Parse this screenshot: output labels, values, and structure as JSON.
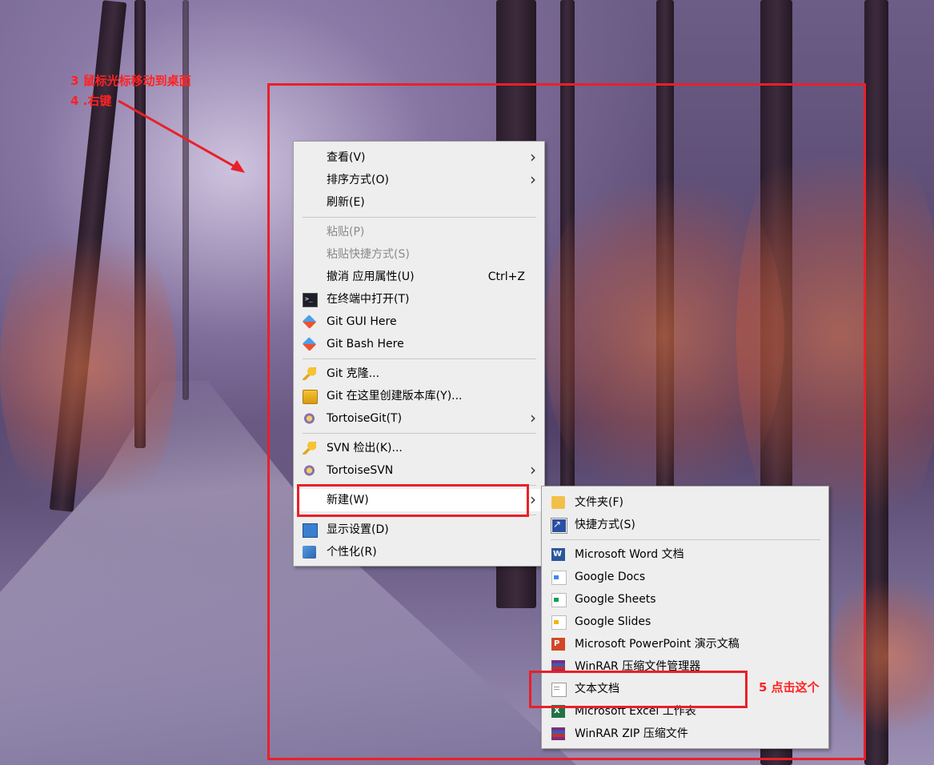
{
  "annotations": {
    "step3": "3 鼠标光标移动到桌面",
    "step4": "4 .右键",
    "step5": "5 点击这个"
  },
  "context_menu": {
    "items": [
      {
        "label": "查看(V)",
        "submenu": true
      },
      {
        "label": "排序方式(O)",
        "submenu": true
      },
      {
        "label": "刷新(E)"
      },
      {
        "label": "粘贴(P)",
        "disabled": true
      },
      {
        "label": "粘贴快捷方式(S)",
        "disabled": true
      },
      {
        "label": "撤消 应用属性(U)",
        "shortcut": "Ctrl+Z"
      },
      {
        "label": "在终端中打开(T)",
        "icon": "terminal-icon"
      },
      {
        "label": "Git GUI Here",
        "icon": "git-icon"
      },
      {
        "label": "Git Bash Here",
        "icon": "git-icon"
      },
      {
        "label": "Git 克隆...",
        "icon": "tortoisegit-clone-icon"
      },
      {
        "label": "Git 在这里创建版本库(Y)...",
        "icon": "repo-create-icon"
      },
      {
        "label": "TortoiseGit(T)",
        "icon": "tortoisegit-icon",
        "submenu": true
      },
      {
        "label": "SVN 检出(K)...",
        "icon": "svn-checkout-icon"
      },
      {
        "label": "TortoiseSVN",
        "icon": "tortoisesvn-icon",
        "submenu": true
      },
      {
        "label": "新建(W)",
        "submenu": true,
        "highlighted": true
      },
      {
        "label": "显示设置(D)",
        "icon": "display-settings-icon"
      },
      {
        "label": "个性化(R)",
        "icon": "personalize-icon"
      }
    ]
  },
  "new_submenu": {
    "items": [
      {
        "label": "文件夹(F)",
        "icon": "folder-icon"
      },
      {
        "label": "快捷方式(S)",
        "icon": "shortcut-icon"
      },
      {
        "label": "Microsoft Word 文档",
        "icon": "word-icon"
      },
      {
        "label": "Google Docs",
        "icon": "google-docs-icon"
      },
      {
        "label": "Google Sheets",
        "icon": "google-sheets-icon"
      },
      {
        "label": "Google Slides",
        "icon": "google-slides-icon"
      },
      {
        "label": "Microsoft PowerPoint 演示文稿",
        "icon": "powerpoint-icon"
      },
      {
        "label": "WinRAR 压缩文件管理器",
        "icon": "winrar-icon"
      },
      {
        "label": "文本文档",
        "icon": "text-document-icon"
      },
      {
        "label": "Microsoft Excel 工作表",
        "icon": "excel-icon"
      },
      {
        "label": "WinRAR ZIP 压缩文件",
        "icon": "winrar-zip-icon"
      }
    ]
  },
  "colors": {
    "annotation": "#ff2222",
    "menu_bg": "#eeeeee",
    "highlight_box": "#e8202a"
  }
}
